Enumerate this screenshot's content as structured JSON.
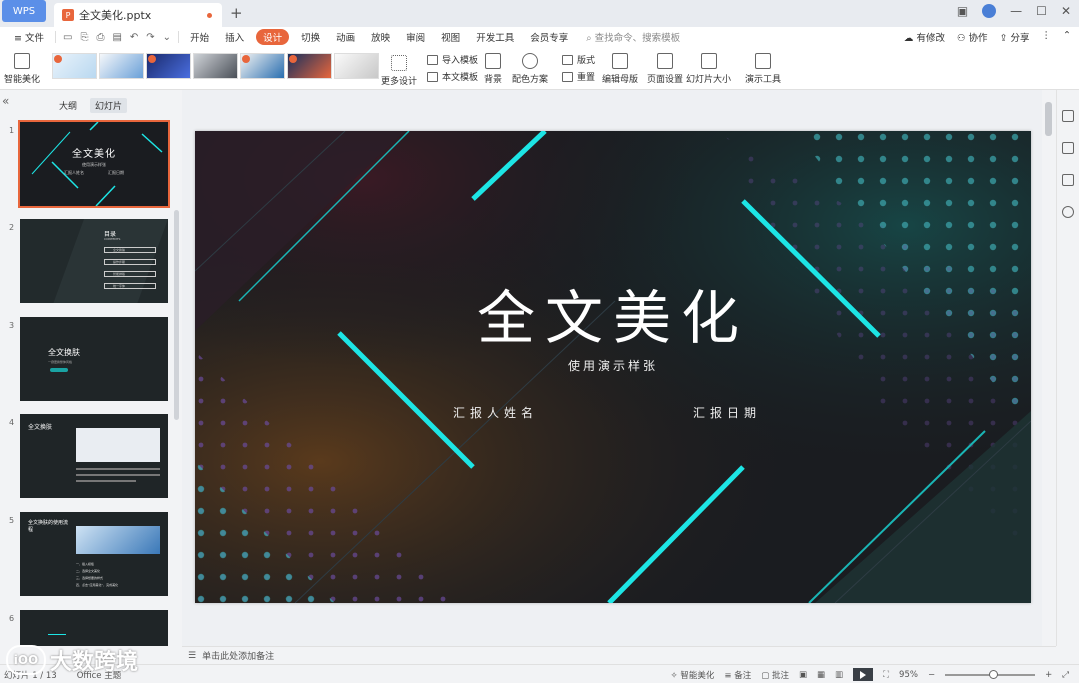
{
  "titlebar": {
    "app_tab": "WPS",
    "doc_tab": "全文美化.pptx",
    "new_tab": "+"
  },
  "menubar": {
    "file": "≡ 文件",
    "tabs": [
      "开始",
      "插入",
      "设计",
      "切换",
      "动画",
      "放映",
      "审阅",
      "视图",
      "开发工具",
      "会员专享"
    ],
    "active_tab": "设计",
    "search_placeholder": "查找命令、搜索模板",
    "right": [
      "有修改",
      "协作",
      "分享"
    ]
  },
  "ribbon": {
    "smart_beautify": "智能美化",
    "more_design": "更多设计",
    "import_template": "导入模板",
    "this_template": "本文模板",
    "background": "背景",
    "color_scheme": "配色方案",
    "layout": "版式",
    "reset": "重置",
    "edit_master": "编辑母版",
    "page_setup": "页面设置",
    "slide_size": "幻灯片大小",
    "present_tools": "演示工具"
  },
  "leftpane": {
    "view_outline": "大纲",
    "view_slides": "幻灯片",
    "slides": [
      {
        "num": "1",
        "title": "全文美化",
        "sub": "使用演示样张",
        "meta_l": "汇报人姓名",
        "meta_r": "汇报日期"
      },
      {
        "num": "2",
        "title": "目录",
        "sub": "CONTENTS",
        "items": [
          "全文换肤",
          "操作步骤",
          "智能排版",
          "统一字体"
        ]
      },
      {
        "num": "3",
        "title": "全文换肤",
        "sub": "一键更换整体风格"
      },
      {
        "num": "4",
        "title": "全文换肤"
      },
      {
        "num": "5",
        "title": "全文换肤的使用流程",
        "items": [
          "一、插入模板",
          "二、选择全文美化",
          "三、选择想要的样式",
          "四、点击“应用美化”，完成美化"
        ]
      },
      {
        "num": "6",
        "title": ""
      }
    ]
  },
  "slide": {
    "title": "全文美化",
    "subtitle": "使用演示样张",
    "presenter": "汇报人姓名",
    "date": "汇报日期"
  },
  "notes_placeholder": "单击此处添加备注",
  "status": {
    "slide_count": "幻灯片 1 / 13",
    "theme": "Office 主题",
    "smart": "智能美化",
    "notes": "备注",
    "comments": "批注",
    "zoom": "95%"
  },
  "watermark": "大数跨境",
  "colors": {
    "accent": "#e8663c",
    "cyan": "#1de5e5",
    "slide_bg": "#1a1c20"
  }
}
